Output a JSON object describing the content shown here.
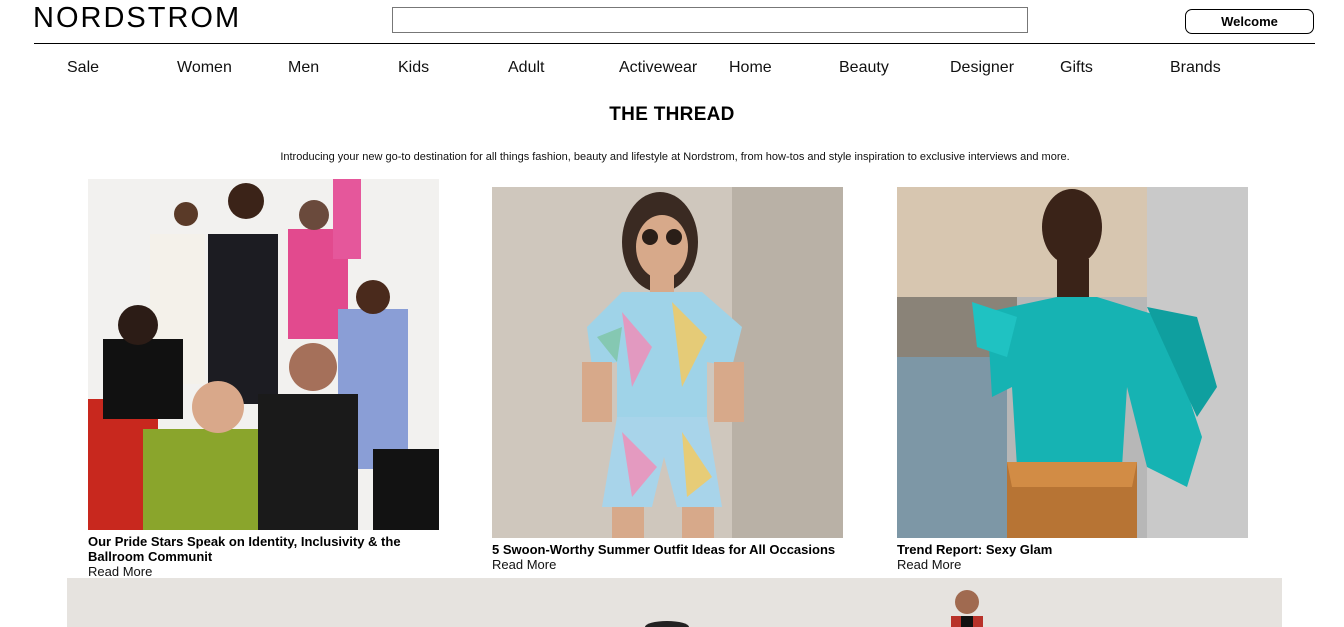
{
  "header": {
    "logo": "NORDSTROM",
    "search_value": "",
    "welcome_label": "Welcome"
  },
  "nav": {
    "items": [
      "Sale",
      "Women",
      "Men",
      "Kids",
      "Adult",
      "Activewear",
      "Home",
      "Beauty",
      "Designer",
      "Gifts",
      "Brands"
    ]
  },
  "thread": {
    "title": "THE THREAD",
    "intro": "Introducing your new go-to destination for all things fashion, beauty and lifestyle at Nordstrom, from how-tos and style inspiration to exclusive interviews and more."
  },
  "articles": [
    {
      "title": "Our Pride Stars Speak on Identity, Inclusivity & the Ballroom Communit",
      "link": "Read More"
    },
    {
      "title": "5 Swoon-Worthy Summer Outfit Ideas for All Occasions",
      "link": "Read More"
    },
    {
      "title": "Trend Report: Sexy Glam",
      "link": "Read More"
    }
  ],
  "colors": {
    "text": "#000000",
    "border": "#777777",
    "banner_bg": "#e6e3df"
  }
}
